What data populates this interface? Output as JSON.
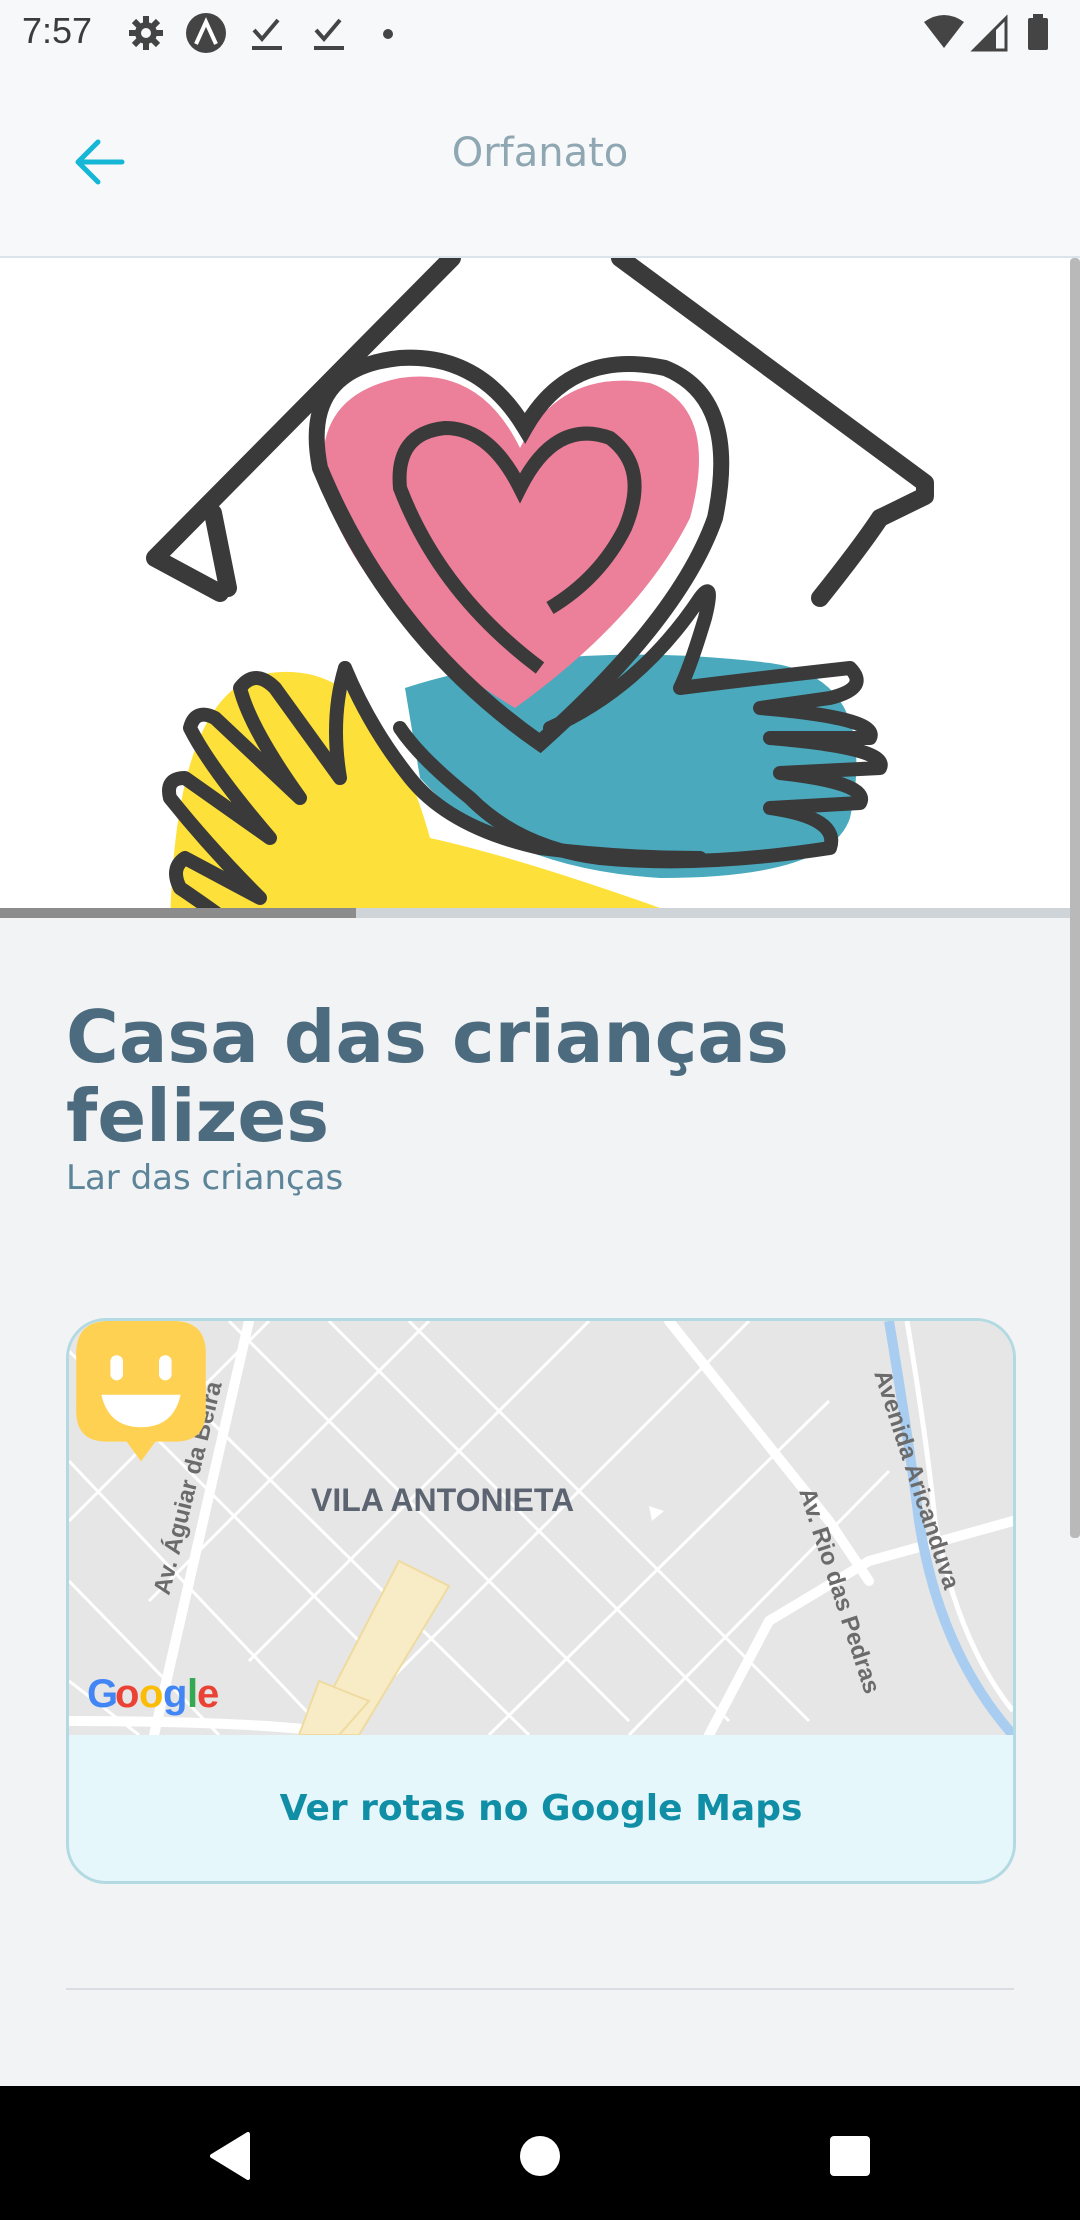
{
  "status_bar": {
    "time": "7:57",
    "left_icons": [
      "gear-icon",
      "a-circle-icon",
      "download-done-icon",
      "download-done-icon",
      "dot-icon"
    ],
    "right_icons": [
      "wifi-icon",
      "signal-icon",
      "battery-icon"
    ]
  },
  "app_bar": {
    "back_icon": "arrow-left-icon",
    "title": "Orfanato",
    "accent_color": "#15b6d6"
  },
  "hero": {
    "image": "house-heart-hands-illustration",
    "scroll_progress": 0.33
  },
  "place": {
    "name": "Casa das crianças felizes",
    "about": "Lar das crianças"
  },
  "map": {
    "labels": {
      "street_1": "Av. Águiar da Beira",
      "district": "VILA ANTONIETA",
      "street_2": "Av. Rio das Pedras",
      "street_3": "Avenida Aricanduva",
      "provider": "Google"
    },
    "marker_icon": "smiley-marker-icon",
    "marker_color": "#ffd152",
    "directions_label": "Ver rotas no Google Maps"
  },
  "nav_bar": {
    "back": "nav-back-icon",
    "home": "nav-home-icon",
    "recents": "nav-recents-icon"
  }
}
